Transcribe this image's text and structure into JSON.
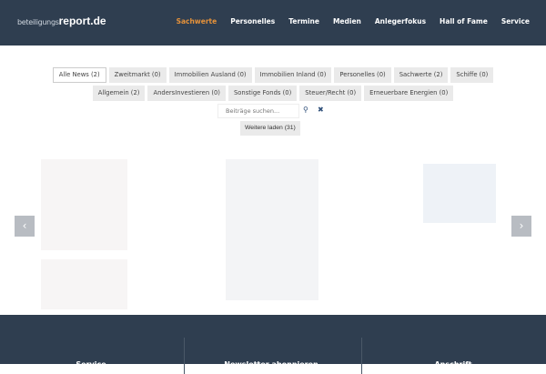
{
  "header": {
    "logo_prefix": "beteiligungs",
    "logo_main": "report.de",
    "nav": [
      {
        "label": "Sachwerte",
        "active": true
      },
      {
        "label": "Personelles"
      },
      {
        "label": "Termine"
      },
      {
        "label": "Medien"
      },
      {
        "label": "Anlegerfokus"
      },
      {
        "label": "Hall of Fame"
      },
      {
        "label": "Service"
      }
    ]
  },
  "filters": [
    {
      "label": "Alle News  (2)",
      "active": true
    },
    {
      "label": "Zweitmarkt  (0)"
    },
    {
      "label": "Immobilien Ausland  (0)"
    },
    {
      "label": "Immobilien Inland  (0)"
    },
    {
      "label": "Personelles  (0)"
    },
    {
      "label": "Sachwerte  (2)"
    },
    {
      "label": "Schiffe  (0)"
    },
    {
      "label": "Allgemein  (2)"
    },
    {
      "label": "AndersInvestieren  (0)"
    },
    {
      "label": "Sonstige Fonds  (0)"
    },
    {
      "label": "Steuer/Recht  (0)"
    },
    {
      "label": "Erneuerbare Energien  (0)"
    }
  ],
  "search": {
    "placeholder": "Beiträge suchen...",
    "search_icon": "search-icon",
    "clear_icon": "close-icon"
  },
  "load_more": "Weitere laden (31)",
  "carousel": {
    "prev": "‹",
    "next": "›"
  },
  "footer": {
    "columns": [
      "Service",
      "Newsletter abonnieren",
      "Anschrift"
    ]
  }
}
